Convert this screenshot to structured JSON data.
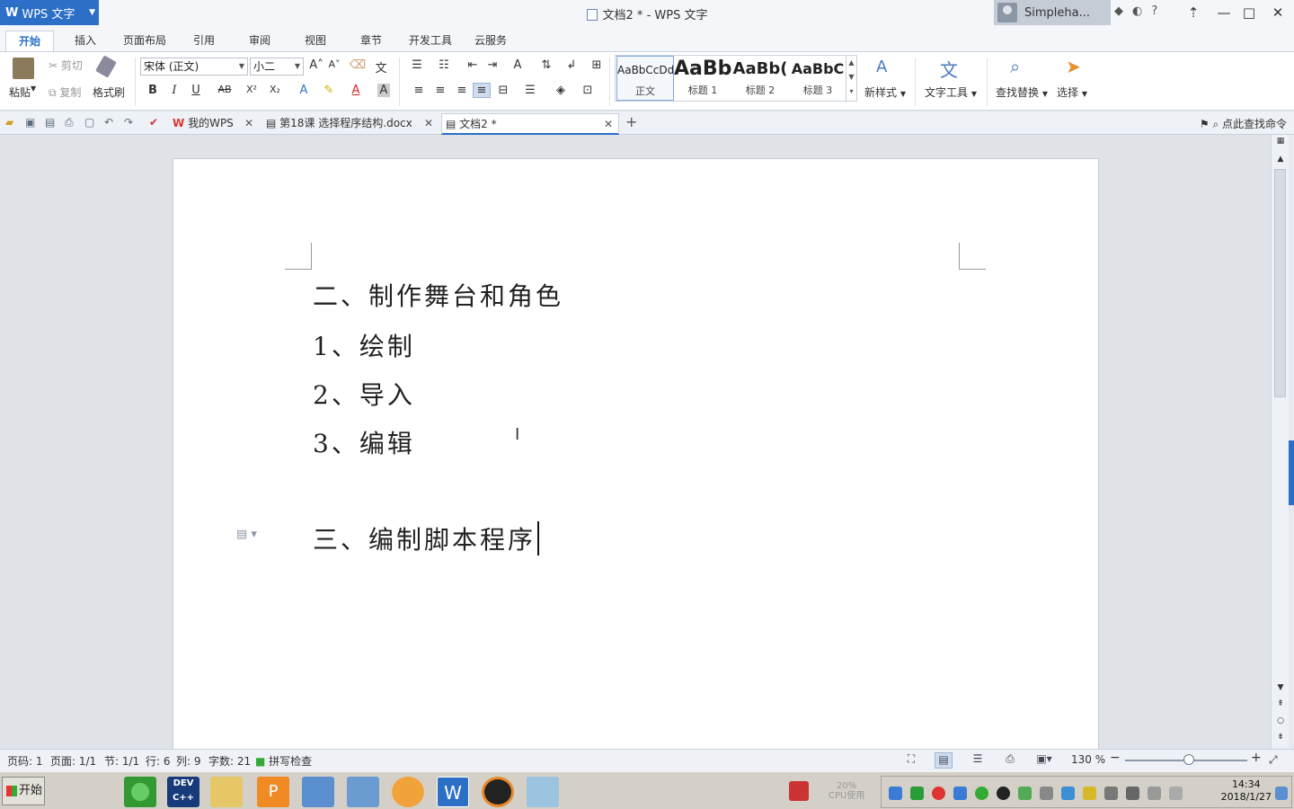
{
  "app": {
    "logo_label": "WPS 文字",
    "window_title": "文档2 * - WPS 文字",
    "user_name": "Simpleha...",
    "title_icons": [
      "shield-icon",
      "skin-icon",
      "help-icon"
    ],
    "help_label": "?"
  },
  "ribbon_tabs": [
    "开始",
    "插入",
    "页面布局",
    "引用",
    "审阅",
    "视图",
    "章节",
    "开发工具",
    "云服务"
  ],
  "ribbon": {
    "paste_label": "粘贴",
    "cut_label": "剪切",
    "copy_label": "复制",
    "format_painter_label": "格式刷",
    "font_name": "宋体 (正文)",
    "font_size": "小二",
    "bold": "B",
    "italic": "I",
    "underline": "U",
    "strike": "AB",
    "superscript": "X²",
    "subscript": "X₂",
    "styles": [
      {
        "preview": "AaBbCcDd",
        "name": "正文"
      },
      {
        "preview": "AaBb",
        "name": "标题 1"
      },
      {
        "preview": "AaBb(",
        "name": "标题 2"
      },
      {
        "preview": "AaBbC",
        "name": "标题 3"
      }
    ],
    "new_style_label": "新样式",
    "text_tools_label": "文字工具",
    "find_replace_label": "查找替换",
    "select_label": "选择"
  },
  "doc_tabs": [
    {
      "label": "我的WPS",
      "active": false
    },
    {
      "label": "第18课 选择程序结构.docx",
      "active": false
    },
    {
      "label": "文档2 *",
      "active": true
    }
  ],
  "find_command_label": "点此查找命令",
  "document": {
    "lines": [
      "二、制作舞台和角色",
      "1、绘制",
      "2、导入",
      "3、编辑",
      "三、编制脚本程序"
    ]
  },
  "status": {
    "page_code": "页码: 1",
    "page": "页面: 1/1",
    "section": "节: 1/1",
    "row": "行: 6",
    "col": "列: 9",
    "word_count": "字数: 21",
    "spell_check": "拼写检查",
    "zoom": "130 %"
  },
  "taskbar": {
    "start_label": "开始",
    "cpu_label": "20%",
    "cpu_caption": "CPU使用",
    "time": "14:34",
    "date": "2018/1/27"
  }
}
